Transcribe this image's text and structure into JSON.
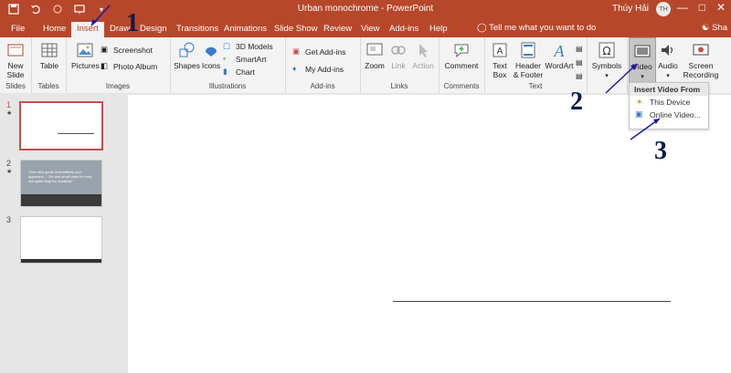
{
  "window": {
    "title": "Urban monochrome  -  PowerPoint",
    "user": "Thúy Hải",
    "user_initials": "TH",
    "minimize": "—",
    "restore": "□",
    "close": "✕"
  },
  "tabs": [
    "File",
    "Home",
    "Insert",
    "Draw",
    "Design",
    "Transitions",
    "Animations",
    "Slide Show",
    "Review",
    "View",
    "Add-ins",
    "Help"
  ],
  "tell_me": "Tell me what you want to do",
  "share": "Sha",
  "ribbon": {
    "slides": {
      "new_slide": "New",
      "new_slide2": "Slide",
      "label": "Slides"
    },
    "tables": {
      "table": "Table",
      "label": "Tables"
    },
    "images": {
      "pictures": "Pictures",
      "screenshot": "Screenshot",
      "photo_album": "Photo Album",
      "label": "Images"
    },
    "illustrations": {
      "shapes": "Shapes",
      "icons": "Icons",
      "models": "3D Models",
      "smartart": "SmartArt",
      "chart": "Chart",
      "label": "Illustrations"
    },
    "addins": {
      "get": "Get Add-ins",
      "my": "My Add-ins",
      "label": "Add-ins"
    },
    "links": {
      "zoom": "Zoom",
      "link": "Link",
      "action": "Action",
      "label": "Links"
    },
    "comments": {
      "comment": "Comment",
      "label": "Comments"
    },
    "text": {
      "textbox1": "Text",
      "textbox2": "Box",
      "header1": "Header",
      "header2": "& Footer",
      "wordart": "WordArt",
      "label": "Text"
    },
    "symbols": {
      "symbols": "Symbols"
    },
    "media": {
      "video": "Video",
      "audio": "Audio",
      "rec1": "Screen",
      "rec2": "Recording"
    }
  },
  "dropdown": {
    "title": "Insert Video From",
    "items": [
      "This Device",
      "Online Video..."
    ]
  },
  "slides": [
    {
      "num": "1",
      "star": "★"
    },
    {
      "num": "2",
      "star": "★",
      "text": "Your next quote that reflects your approach... \"It's one small step for man, one giant leap for mankind.\""
    },
    {
      "num": "3"
    }
  ],
  "annotations": [
    "1",
    "2",
    "3"
  ],
  "colors": {
    "accent": "#b7472a",
    "arrow": "#1a1aa8"
  }
}
